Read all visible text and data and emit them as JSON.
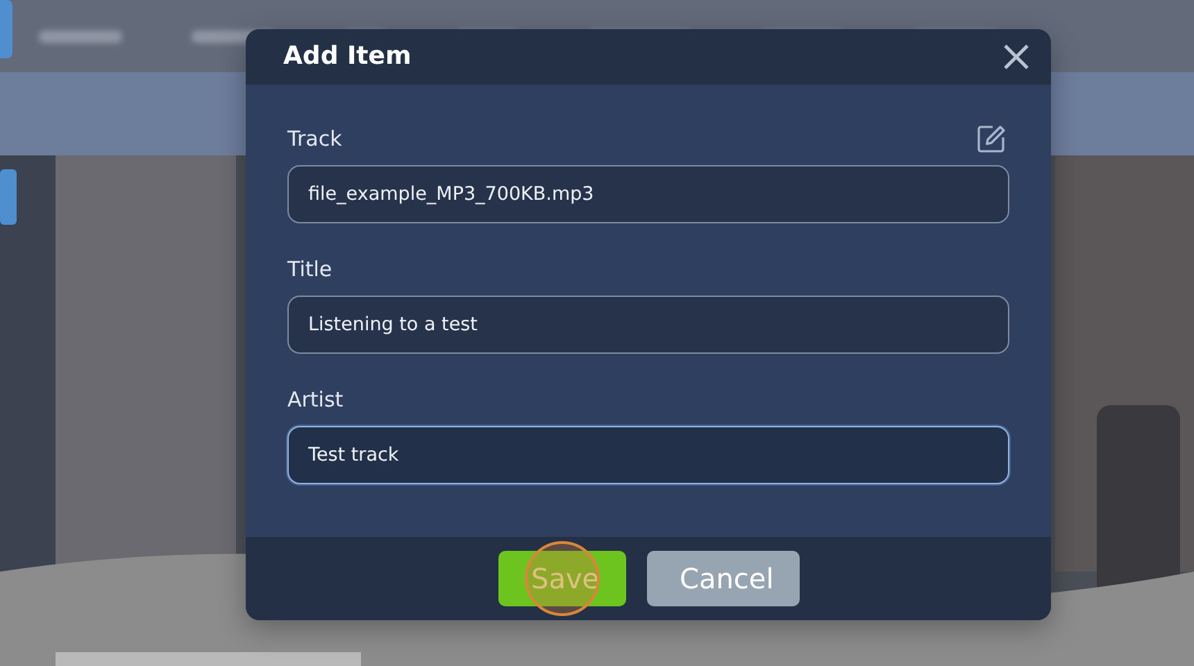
{
  "dialog": {
    "title": "Add Item",
    "fields": [
      {
        "label": "Track",
        "value": "file_example_MP3_700KB.mp3",
        "focused": false,
        "editable_icon": true
      },
      {
        "label": "Title",
        "value": "Listening to a test",
        "focused": false
      },
      {
        "label": "Artist",
        "value": "Test track",
        "focused": true
      }
    ],
    "buttons": [
      {
        "label": "Save",
        "kind": "primary",
        "clicked": true
      },
      {
        "label": "Cancel",
        "kind": "secondary",
        "clicked": false
      }
    ]
  }
}
